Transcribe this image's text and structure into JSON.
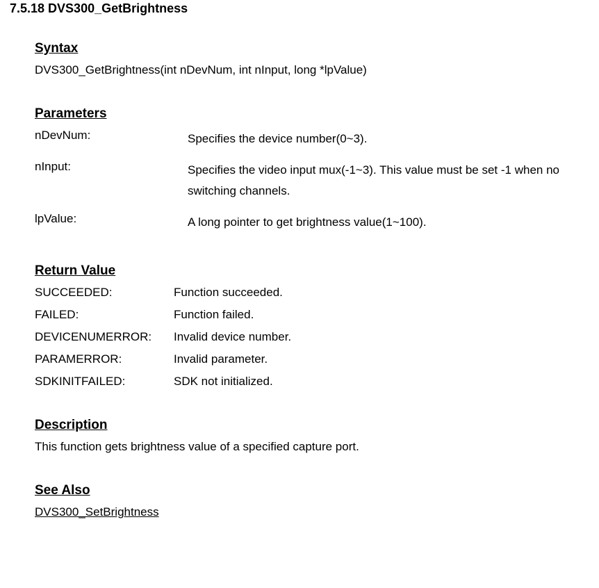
{
  "title": "7.5.18 DVS300_GetBrightness",
  "syntax": {
    "heading": "Syntax",
    "signature": "DVS300_GetBrightness(int nDevNum, int nInput, long *lpValue)"
  },
  "parameters": {
    "heading": "Parameters",
    "items": [
      {
        "name": "nDevNum:",
        "desc": "Specifies the device number(0~3)."
      },
      {
        "name": "nInput:",
        "desc": "Specifies the video input mux(-1~3). This value must be set -1 when no switching channels."
      },
      {
        "name": "lpValue:",
        "desc": "A long pointer to get brightness value(1~100)."
      }
    ]
  },
  "returnValue": {
    "heading": "Return Value",
    "items": [
      {
        "name": "SUCCEEDED:",
        "desc": "Function succeeded."
      },
      {
        "name": "FAILED:",
        "desc": "Function failed."
      },
      {
        "name": "DEVICENUMERROR:",
        "desc": "Invalid device number."
      },
      {
        "name": "PARAMERROR:",
        "desc": "Invalid parameter."
      },
      {
        "name": "SDKINITFAILED:",
        "desc": "SDK not initialized."
      }
    ]
  },
  "description": {
    "heading": "Description",
    "text": "This function gets brightness value of a specified capture port."
  },
  "seeAlso": {
    "heading": "See Also",
    "link": "DVS300_SetBrightness"
  }
}
